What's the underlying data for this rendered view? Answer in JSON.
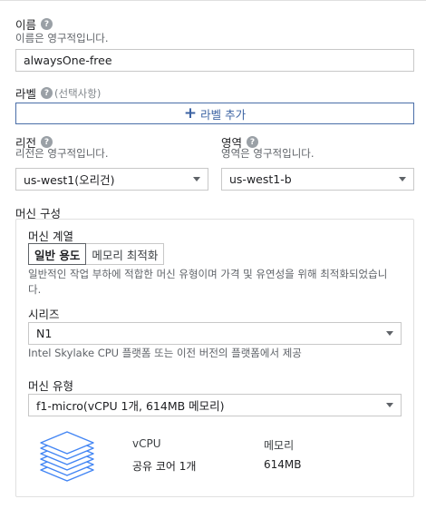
{
  "name": {
    "label": "이름",
    "hint": "이름은 영구적입니다.",
    "value": "alwaysOne-free"
  },
  "labels": {
    "label": "라벨",
    "optional": "(선택사항)",
    "add_button": "라벨 추가"
  },
  "region": {
    "label": "리전",
    "hint": "리전은 영구적입니다.",
    "value": "us-west1(오리건)"
  },
  "zone": {
    "label": "영역",
    "hint": "영역은 영구적입니다.",
    "value": "us-west1-b"
  },
  "machine": {
    "section_title": "머신 구성",
    "family_label": "머신 계열",
    "tabs": [
      "일반 용도",
      "메모리 최적화"
    ],
    "active_tab": "일반 용도",
    "family_desc": "일반적인 작업 부하에 적합한 머신 유형이며 가격 및 유연성을 위해 최적화되었습니다.",
    "series_label": "시리즈",
    "series_value": "N1",
    "series_desc": "Intel Skylake CPU 플랫폼 또는 이전 버전의 플랫폼에서 제공",
    "type_label": "머신 유형",
    "type_value": "f1-micro(vCPU 1개, 614MB 메모리)",
    "vcpu_header": "vCPU",
    "memory_header": "메모리",
    "vcpu_value": "공유 코어 1개",
    "memory_value": "614MB"
  },
  "icons": {
    "help": "help-icon",
    "plus": "plus-icon",
    "dropdown": "dropdown-caret-icon",
    "machine": "stacked-layers-icon"
  },
  "colors": {
    "accent": "#3c63a3",
    "help": "#9aa0a6",
    "stack_blue": "#4285f4"
  }
}
